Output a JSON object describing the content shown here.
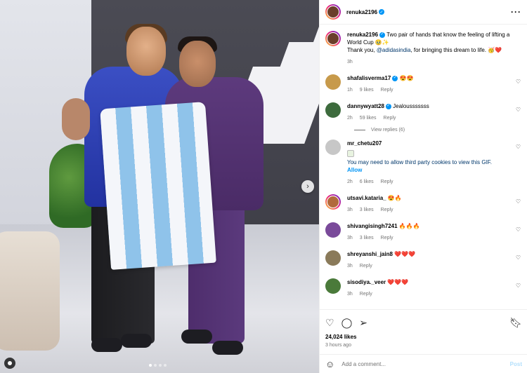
{
  "post": {
    "author": "renuka2196",
    "author_avatar_color": "#6b3e2a",
    "caption_line1": "Two pair of hands that know the feeling of lifting a World Cup 🥹✨",
    "caption_line2_prefix": "Thank you, ",
    "caption_mention": "@adidasindia",
    "caption_line2_suffix": ", for bringing this dream to life. 🥳❤️",
    "caption_time": "3h",
    "likes": "24,024 likes",
    "posted": "3 hours ago"
  },
  "comments": [
    {
      "user": "shafalisverma17",
      "verified": true,
      "text": "😍😍",
      "time": "1h",
      "likes": "9 likes",
      "reply": "Reply",
      "avatar_color": "#c79a4b"
    },
    {
      "user": "dannywyatt28",
      "verified": true,
      "text": "Jealousssssss",
      "time": "2h",
      "likes": "59 likes",
      "reply": "Reply",
      "avatar_color": "#3d6b3d"
    },
    {
      "user": "mr_chetu207",
      "verified": false,
      "gif_note": "You may need to allow third party cookies to view this GIF.",
      "allow": "Allow",
      "time": "2h",
      "likes": "6 likes",
      "reply": "Reply",
      "avatar_color": "#c7c7c7"
    },
    {
      "user": "utsavi.kataria_",
      "verified": false,
      "text": "😍🔥",
      "time": "3h",
      "likes": "3 likes",
      "reply": "Reply",
      "avatar_color": "#b26a3c"
    },
    {
      "user": "shivangisingh7241",
      "verified": false,
      "text": "🔥🔥🔥",
      "time": "3h",
      "likes": "3 likes",
      "reply": "Reply",
      "avatar_color": "#7a4a9a"
    },
    {
      "user": "shreyanshi_jain8",
      "verified": false,
      "text": "❤️❤️❤️",
      "time": "3h",
      "reply": "Reply",
      "avatar_color": "#8a7a5a"
    },
    {
      "user": "sisodiya._veer",
      "verified": false,
      "text": "❤️❤️❤️",
      "time": "3h",
      "reply": "Reply",
      "avatar_color": "#4a7a3a"
    }
  ],
  "view_replies": "View replies (6)",
  "add_comment_placeholder": "Add a comment...",
  "post_button": "Post",
  "carousel": {
    "slide": 1,
    "total": 4
  }
}
